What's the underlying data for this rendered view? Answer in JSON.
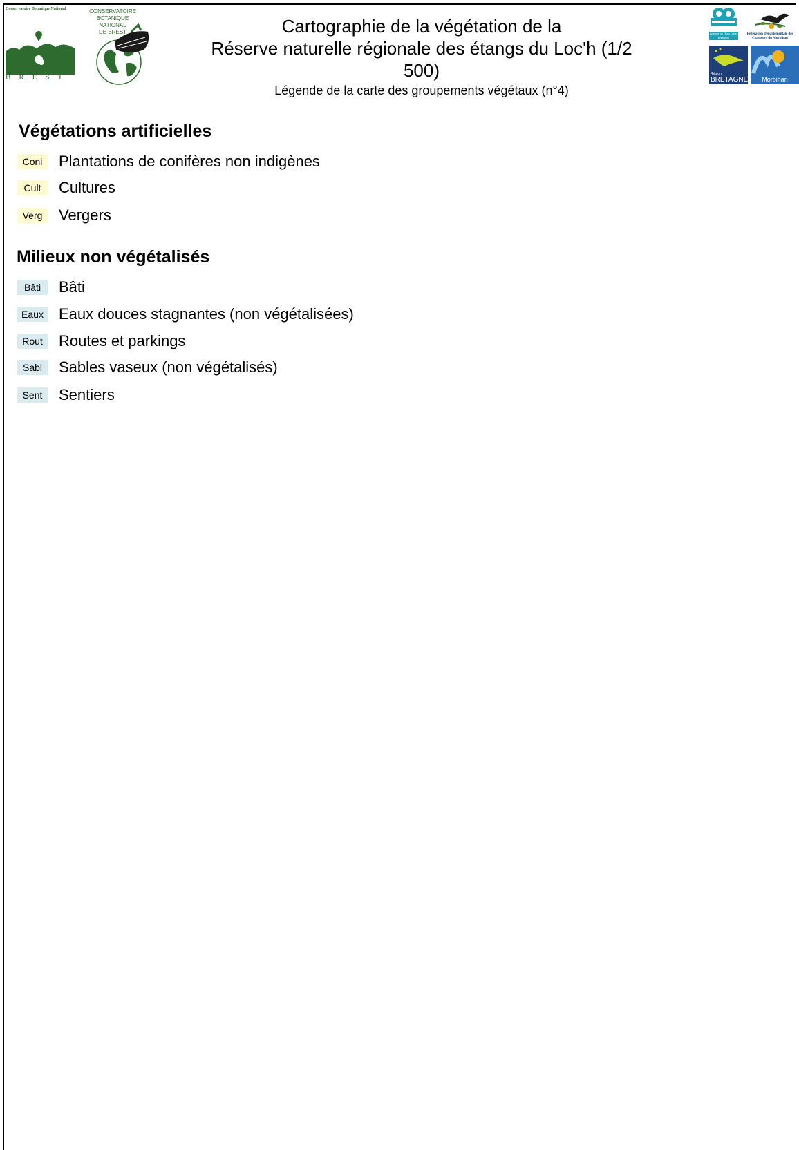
{
  "header": {
    "title_line1": "Cartographie de la végétation de la",
    "title_line2": "Réserve naturelle régionale des étangs du Loc'h (1/2 500)",
    "title_line3": "Légende de la carte des groupements végétaux (n°4)"
  },
  "logos": {
    "cbn_small": "Conservatoire Botanique National",
    "cbn_brest": "BREST",
    "conservatoire_lines": [
      "CONSERVATOIRE",
      "BOTANIQUE",
      "NATIONAL",
      "DE BREST"
    ],
    "agence_eau": "Agence de l'Eau Loire-Bretagne",
    "federation": "Fédération Départementale des Chasseurs du Morbihan",
    "region_small": "Région",
    "region": "BRETAGNE",
    "morbihan": "Morbihan"
  },
  "colors": {
    "brand_green": "#2e6b2f",
    "swatch_yellow": "#fffbd0",
    "swatch_blue": "#d9ebee"
  },
  "sections": [
    {
      "heading": "Végétations artificielles",
      "items": [
        {
          "code": "Coni",
          "label": "Plantations de conifères non indigènes"
        },
        {
          "code": "Cult",
          "label": "Cultures"
        },
        {
          "code": "Verg",
          "label": "Vergers"
        }
      ]
    },
    {
      "heading": "Milieux non végétalisés",
      "items": [
        {
          "code": "Bâti",
          "label": "Bâti"
        },
        {
          "code": "Eaux",
          "label": "Eaux douces stagnantes (non végétalisées)"
        },
        {
          "code": "Rout",
          "label": "Routes et parkings"
        },
        {
          "code": "Sabl",
          "label": "Sables vaseux (non végétalisés)"
        },
        {
          "code": "Sent",
          "label": "Sentiers"
        }
      ]
    }
  ]
}
